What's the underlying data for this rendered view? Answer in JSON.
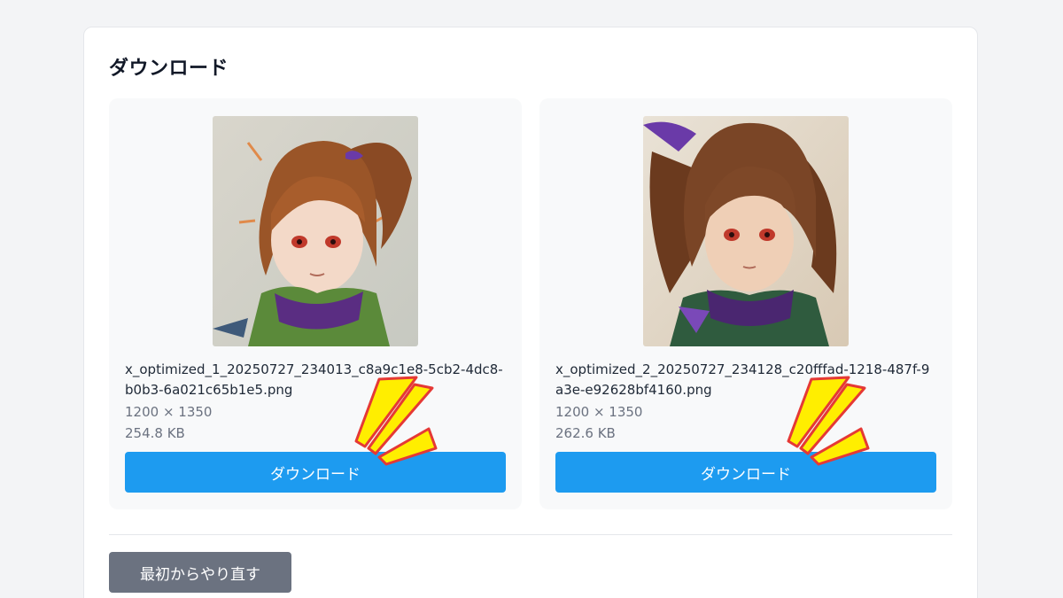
{
  "section": {
    "title": "ダウンロード"
  },
  "images": [
    {
      "filename": "x_optimized_1_20250727_234013_c8a9c1e8-5cb2-4dc8-b0b3-6a021c65b1e5.png",
      "dimensions": "1200 × 1350",
      "size": "254.8 KB",
      "button_label": "ダウンロード"
    },
    {
      "filename": "x_optimized_2_20250727_234128_c20fffad-1218-487f-9a3e-e92628bf4160.png",
      "dimensions": "1200 × 1350",
      "size": "262.6 KB",
      "button_label": "ダウンロード"
    }
  ],
  "footer": {
    "restart_label": "最初からやり直す"
  },
  "colors": {
    "download_button": "#1d9bf0",
    "restart_button": "#6b7280",
    "burst_fill": "#ffee00",
    "burst_stroke": "#e53935"
  },
  "decorations": {
    "highlight_marks": "yellow-burst-icon"
  }
}
